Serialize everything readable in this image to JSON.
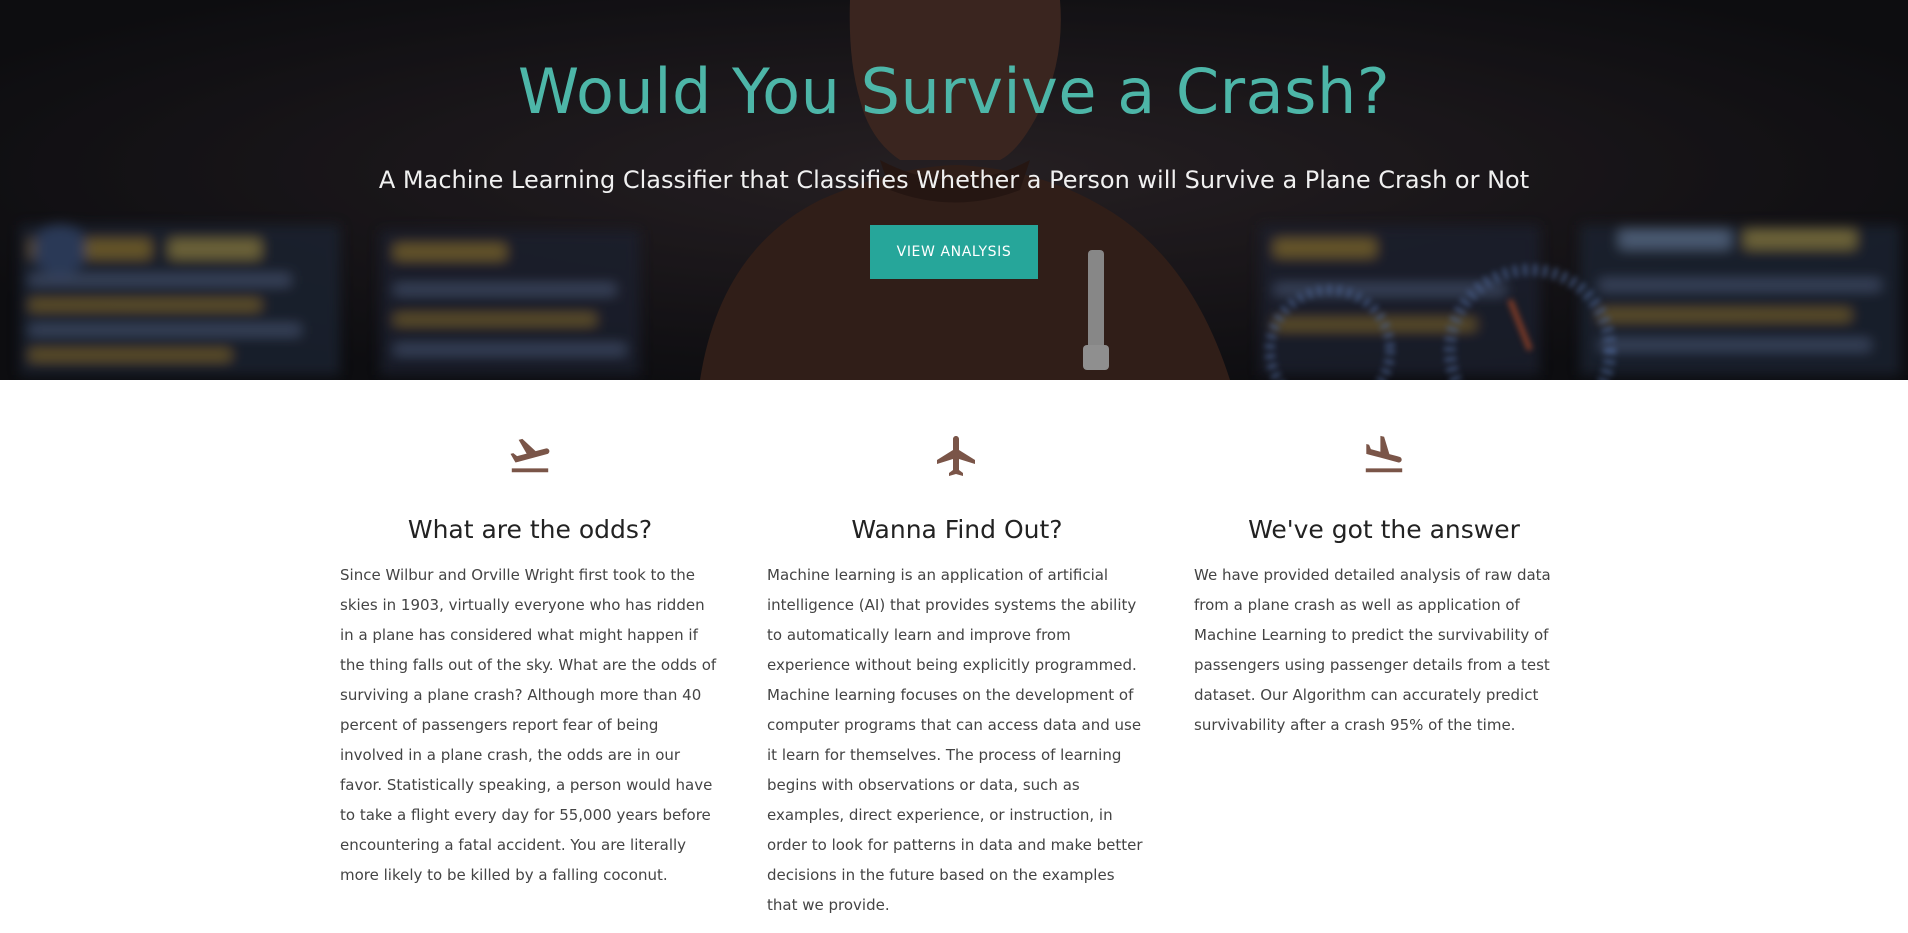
{
  "hero": {
    "title": "Would You Survive a Crash?",
    "subtitle": "A Machine Learning Classifier that Classifies Whether a Person will Survive a Plane Crash or Not",
    "button_label": "VIEW ANALYSIS"
  },
  "features": [
    {
      "icon": "flight-takeoff-icon",
      "heading": "What are the odds?",
      "body": "Since Wilbur and Orville Wright first took to the skies in 1903, virtually everyone who has ridden in a plane has considered what might happen if the thing falls out of the sky. What are the odds of surviving a plane crash? Although more than 40 percent of passengers report fear of being involved in a plane crash, the odds are in our favor. Statistically speaking, a person would have to take a flight every day for 55,000 years before encountering a fatal accident. You are literally more likely to be killed by a falling coconut."
    },
    {
      "icon": "airplane-icon",
      "heading": "Wanna Find Out?",
      "body": "Machine learning is an application of artificial intelligence (AI) that provides systems the ability to automatically learn and improve from experience without being explicitly programmed. Machine learning focuses on the development of computer programs that can access data and use it learn for themselves. The process of learning begins with observations or data, such as examples, direct experience, or instruction, in order to look for patterns in data and make better decisions in the future based on the examples that we provide."
    },
    {
      "icon": "flight-landing-icon",
      "heading": "We've got the answer",
      "body": "We have provided detailed analysis of raw data from a plane crash as well as application of Machine Learning to predict the survivability of passengers using passenger details from a test dataset. Our Algorithm can accurately predict survivability after a crash 95% of the time."
    }
  ],
  "colors": {
    "accent": "#4db6a8",
    "button": "#26a69a",
    "icon": "#7a5548"
  }
}
